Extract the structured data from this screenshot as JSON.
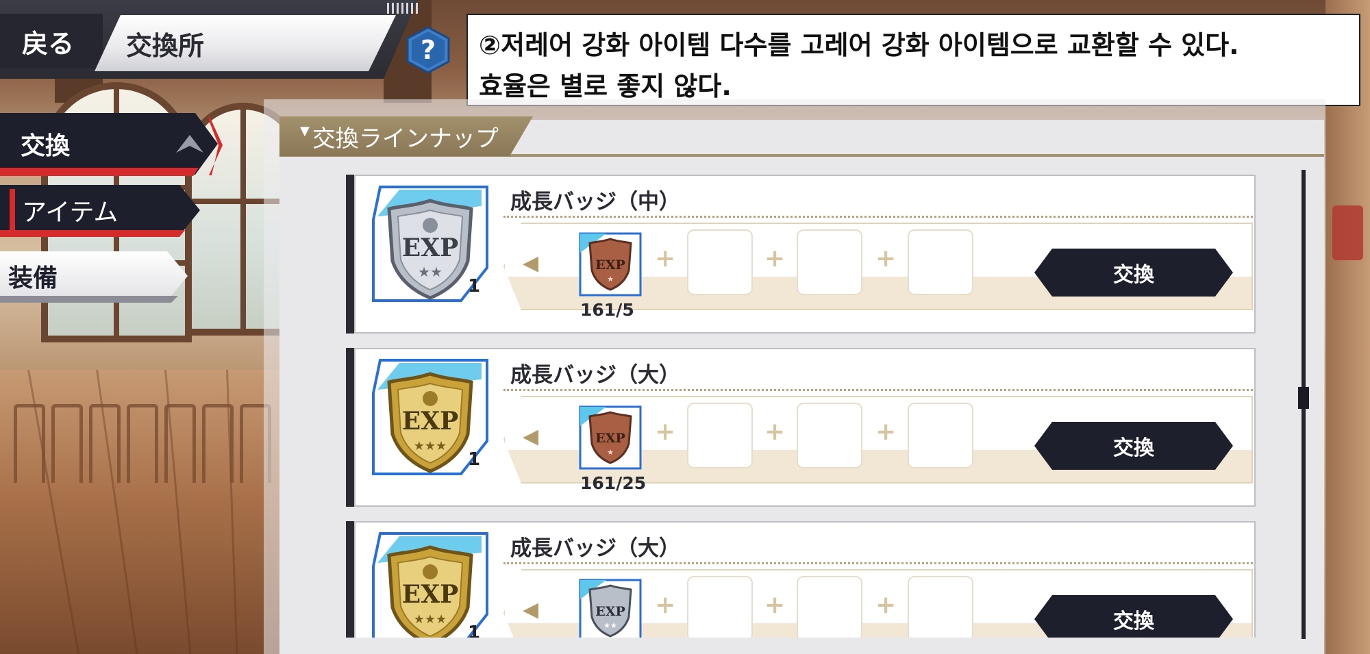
{
  "header": {
    "back_label": "戻る",
    "title": "交換所",
    "help_label": "?"
  },
  "callout": {
    "line1": "②저레어 강화 아이템 다수를 고레어 강화 아이템으로 교환할 수 있다.",
    "line2": "효율은 별로 좋지 않다."
  },
  "menu": {
    "exchange_label": "交換",
    "items_label": "アイテム",
    "equipment_label": "装備"
  },
  "panel": {
    "tab_label": "交換ラインナップ"
  },
  "cards": [
    {
      "name": "成長バッジ（中）",
      "reward_quantity": "1",
      "reward_icon": "exp-badge-silver-icon",
      "material_icon": "exp-badge-bronze-icon",
      "material_count": "161/5",
      "exchange_label": "交換"
    },
    {
      "name": "成長バッジ（大）",
      "reward_quantity": "1",
      "reward_icon": "exp-badge-gold-icon",
      "material_icon": "exp-badge-bronze-icon",
      "material_count": "161/25",
      "exchange_label": "交換"
    },
    {
      "name": "成長バッジ（大）",
      "reward_quantity": "1",
      "reward_icon": "exp-badge-gold-icon",
      "material_icon": "exp-badge-silver-icon",
      "material_count": "",
      "exchange_label": "交換"
    }
  ],
  "badge_text": "EXP",
  "colors": {
    "dark_navy": "#1d1f2c",
    "accent_red": "#d52b2d",
    "tab_gold": "#a3906c",
    "silver": "#b9bfc8",
    "gold": "#c9a23a",
    "bronze": "#a85f44",
    "blue_frame": "#2a6fd6"
  }
}
